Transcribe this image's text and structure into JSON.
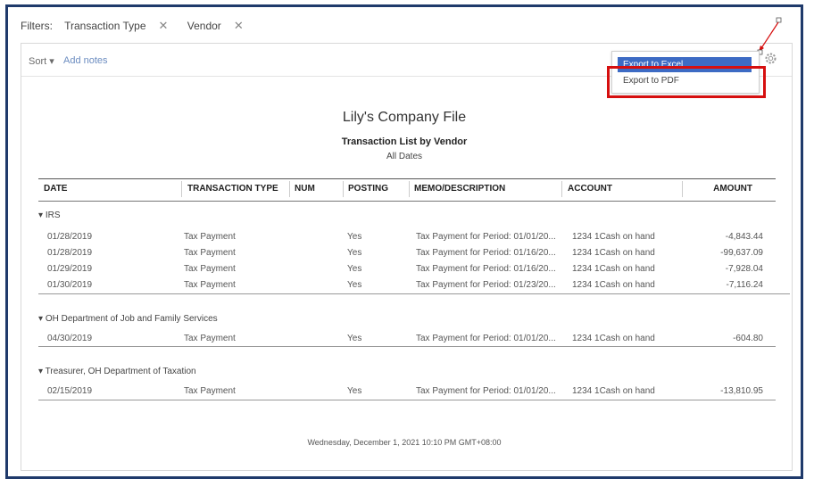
{
  "filters": {
    "label": "Filters:",
    "chips": [
      "Transaction Type",
      "Vendor"
    ],
    "remove_glyph": "✕"
  },
  "toolbar": {
    "sort_label": "Sort",
    "add_notes_label": "Add notes",
    "icons": [
      "email-icon",
      "print-icon",
      "export-icon",
      "gear-icon"
    ]
  },
  "export_menu": {
    "excel_label": "Export to Excel",
    "pdf_label": "Export to PDF"
  },
  "report": {
    "company": "Lily's Company File",
    "title": "Transaction List by Vendor",
    "dates": "All Dates"
  },
  "columns": [
    "DATE",
    "TRANSACTION TYPE",
    "NUM",
    "POSTING",
    "MEMO/DESCRIPTION",
    "ACCOUNT",
    "AMOUNT"
  ],
  "groups": [
    {
      "name": "IRS",
      "rows": [
        {
          "date": "01/28/2019",
          "type": "Tax Payment",
          "posting": "Yes",
          "memo": "Tax Payment for Period: 01/01/20...",
          "account": "1234 1Cash on hand",
          "amount": "-4,843.44"
        },
        {
          "date": "01/28/2019",
          "type": "Tax Payment",
          "posting": "Yes",
          "memo": "Tax Payment for Period: 01/16/20...",
          "account": "1234 1Cash on hand",
          "amount": "-99,637.09"
        },
        {
          "date": "01/29/2019",
          "type": "Tax Payment",
          "posting": "Yes",
          "memo": "Tax Payment for Period: 01/16/20...",
          "account": "1234 1Cash on hand",
          "amount": "-7,928.04"
        },
        {
          "date": "01/30/2019",
          "type": "Tax Payment",
          "posting": "Yes",
          "memo": "Tax Payment for Period: 01/23/20...",
          "account": "1234 1Cash on hand",
          "amount": "-7,116.24"
        }
      ]
    },
    {
      "name": "OH Department of Job and Family Services",
      "rows": [
        {
          "date": "04/30/2019",
          "type": "Tax Payment",
          "posting": "Yes",
          "memo": "Tax Payment for Period: 01/01/20...",
          "account": "1234 1Cash on hand",
          "amount": "-604.80"
        }
      ]
    },
    {
      "name": "Treasurer, OH Department of Taxation",
      "rows": [
        {
          "date": "02/15/2019",
          "type": "Tax Payment",
          "posting": "Yes",
          "memo": "Tax Payment for Period: 01/01/20...",
          "account": "1234 1Cash on hand",
          "amount": "-13,810.95"
        }
      ]
    }
  ],
  "footer": "Wednesday, December 1, 2021   10:10 PM GMT+08:00"
}
